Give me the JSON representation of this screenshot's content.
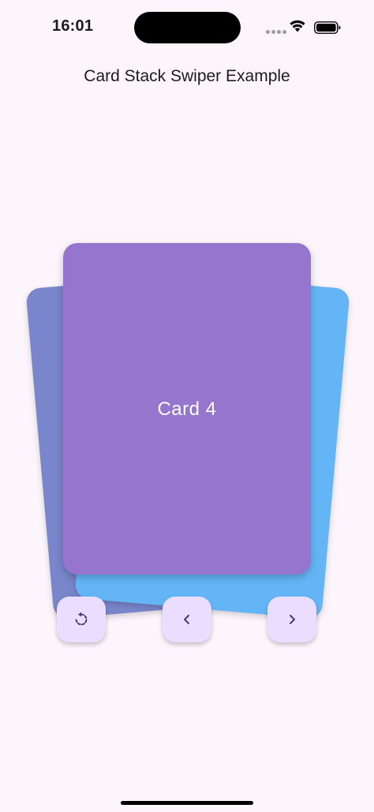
{
  "status_bar": {
    "time": "16:01"
  },
  "app_bar": {
    "title": "Card Stack Swiper Example"
  },
  "cards": {
    "front": {
      "label": "Card 4",
      "color": "#9575CD"
    },
    "back_left_color": "#7986CB",
    "back_right_color": "#64B5F6"
  },
  "controls": [
    {
      "icon": "undo-icon"
    },
    {
      "icon": "chevron-left-icon"
    },
    {
      "icon": "chevron-right-icon"
    }
  ],
  "colors": {
    "background": "#FCF5FC",
    "button_background": "#EADDFF",
    "button_icon": "#4A3A78"
  }
}
